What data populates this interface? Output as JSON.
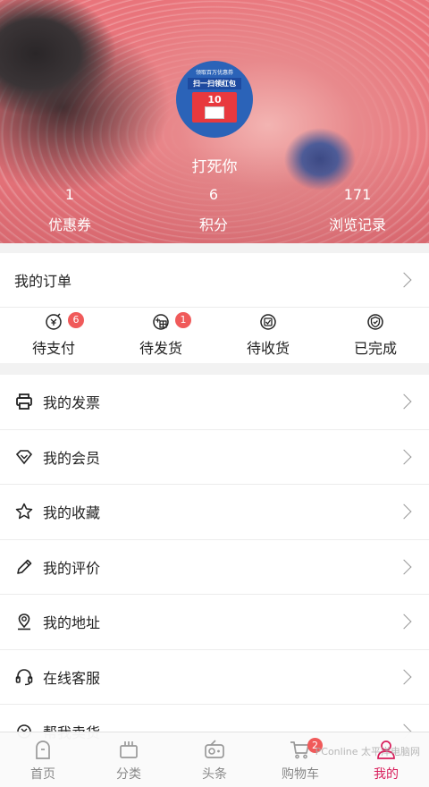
{
  "profile": {
    "username": "打死你",
    "avatar_text": {
      "top": "领取百万优惠券",
      "banner": "扫一扫领红包",
      "amount": "10"
    }
  },
  "stats": [
    {
      "value": "1",
      "label": "优惠券"
    },
    {
      "value": "6",
      "label": "积分"
    },
    {
      "value": "171",
      "label": "浏览记录"
    }
  ],
  "orders": {
    "title": "我的订单",
    "items": [
      {
        "label": "待支付",
        "badge": "6",
        "icon": "wallet-yen-icon"
      },
      {
        "label": "待发货",
        "badge": "1",
        "icon": "box-add-icon"
      },
      {
        "label": "待收货",
        "badge": "",
        "icon": "receive-icon"
      },
      {
        "label": "已完成",
        "badge": "",
        "icon": "shield-check-icon"
      }
    ]
  },
  "menu": [
    {
      "label": "我的发票",
      "icon": "printer-icon"
    },
    {
      "label": "我的会员",
      "icon": "diamond-icon"
    },
    {
      "label": "我的收藏",
      "icon": "star-icon"
    },
    {
      "label": "我的评价",
      "icon": "pencil-icon"
    },
    {
      "label": "我的地址",
      "icon": "location-pin-icon"
    },
    {
      "label": "在线客服",
      "icon": "headset-icon"
    },
    {
      "label": "帮我卖货",
      "icon": "sell-icon"
    }
  ],
  "tabbar": [
    {
      "label": "首页",
      "icon": "home-icon"
    },
    {
      "label": "分类",
      "icon": "category-icon"
    },
    {
      "label": "头条",
      "icon": "radio-icon"
    },
    {
      "label": "购物车",
      "icon": "cart-icon",
      "badge": "2"
    },
    {
      "label": "我的",
      "icon": "user-icon",
      "active": true
    }
  ],
  "watermark": "PConline 太平洋电脑网",
  "colors": {
    "accent": "#d81e5b",
    "badge": "#f05a5a"
  }
}
